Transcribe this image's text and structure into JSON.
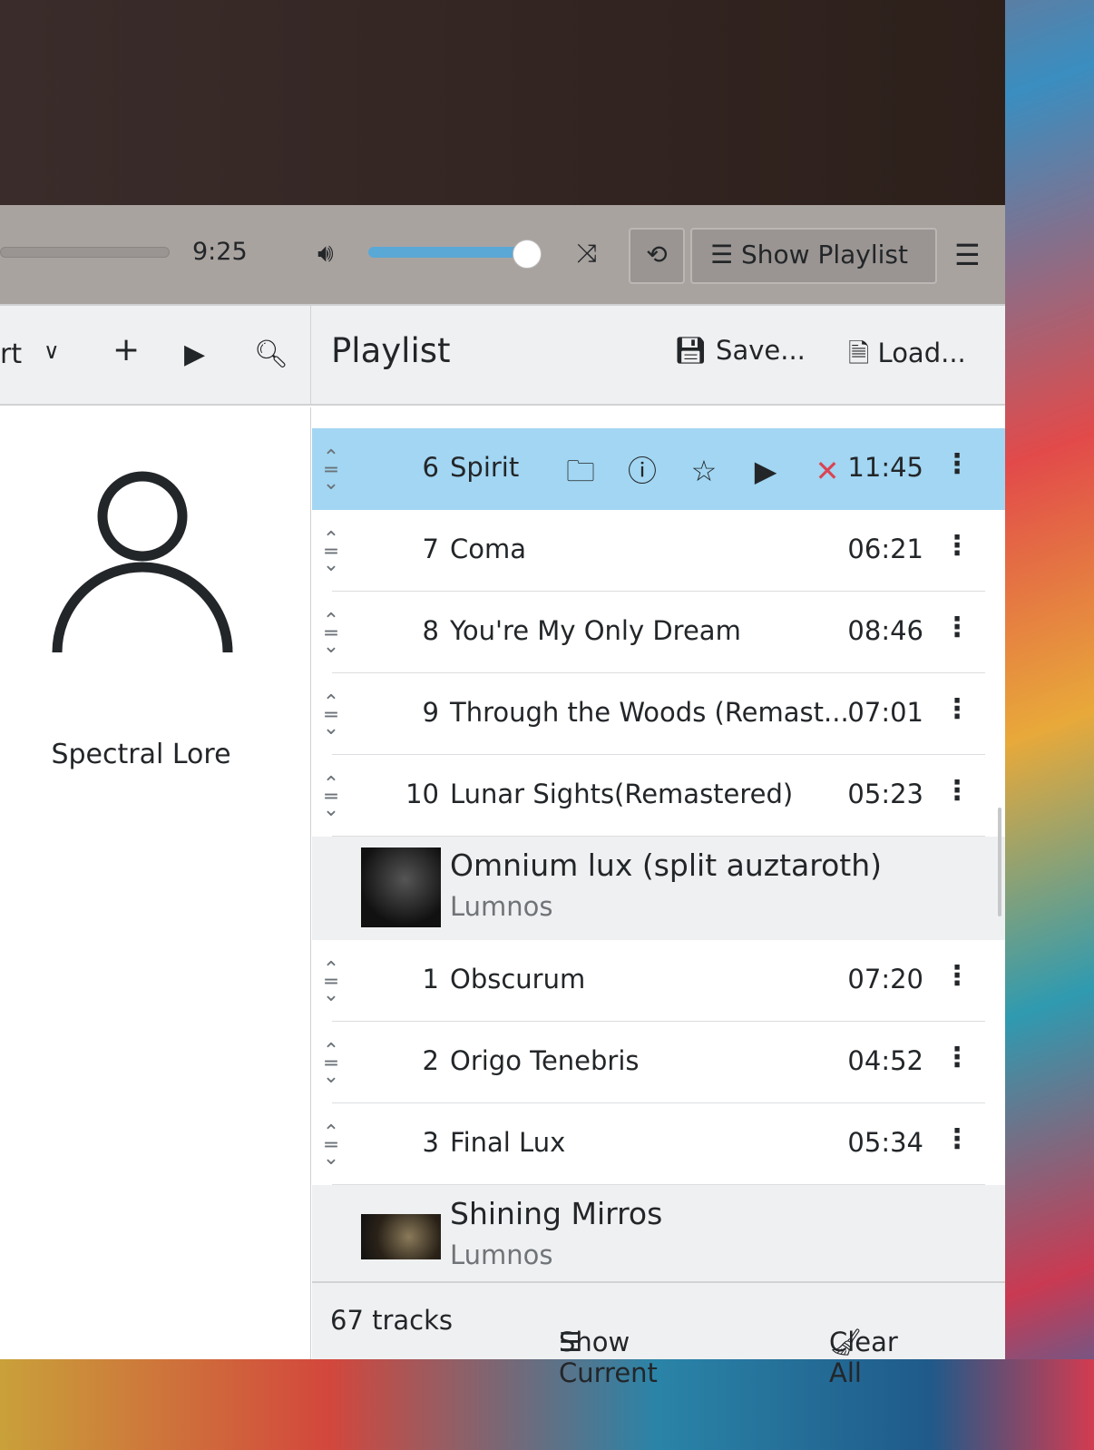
{
  "player": {
    "time": "9:25",
    "volume_percent": 100,
    "show_playlist": "Show Playlist"
  },
  "left": {
    "sort_fragment": "rt",
    "artist": "Spectral Lore"
  },
  "playlist": {
    "title": "Playlist",
    "save": "Save...",
    "load": "Load...",
    "items": [
      {
        "type": "track",
        "num": "6",
        "title": "Spirit",
        "duration": "11:45",
        "active": true
      },
      {
        "type": "track",
        "num": "7",
        "title": "Coma",
        "duration": "06:21"
      },
      {
        "type": "track",
        "num": "8",
        "title": "You're My Only Dream",
        "duration": "08:46"
      },
      {
        "type": "track",
        "num": "9",
        "title": "Through the Woods (Remast...",
        "duration": "07:01"
      },
      {
        "type": "track",
        "num": "10",
        "title": "Lunar Sights(Remastered)",
        "duration": "05:23"
      },
      {
        "type": "album",
        "title": "Omnium lux (split auztaroth)",
        "artist": "Lumnos"
      },
      {
        "type": "track",
        "num": "1",
        "title": "Obscurum",
        "duration": "07:20"
      },
      {
        "type": "track",
        "num": "2",
        "title": "Origo Tenebris",
        "duration": "04:52"
      },
      {
        "type": "track",
        "num": "3",
        "title": "Final Lux",
        "duration": "05:34"
      },
      {
        "type": "album",
        "title": "Shining Mirros",
        "artist": "Lumnos"
      }
    ]
  },
  "footer": {
    "count": "67 tracks",
    "show_current": "Show Current",
    "clear_all": "Clear All"
  }
}
